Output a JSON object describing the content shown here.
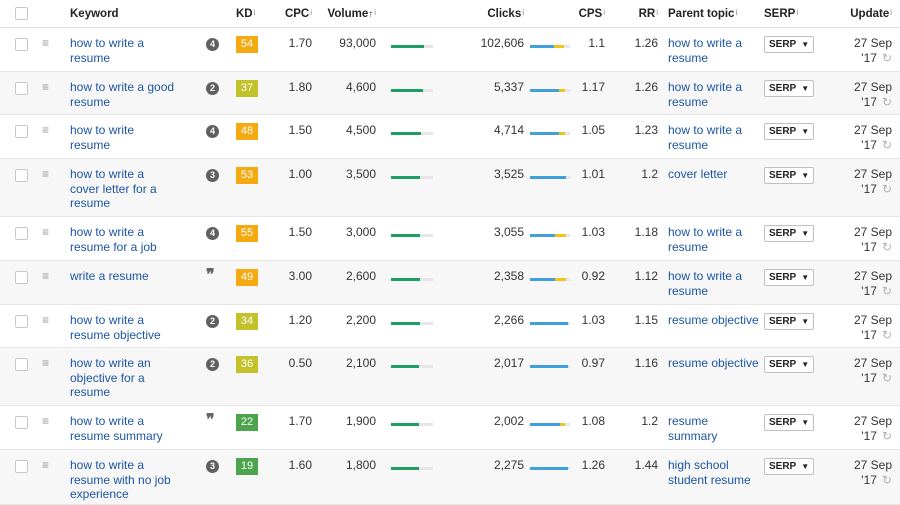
{
  "columns": {
    "keyword": "Keyword",
    "kd": "KD",
    "cpc": "CPC",
    "volume": "Volume",
    "clicks": "Clicks",
    "cps": "CPS",
    "rr": "RR",
    "parent": "Parent topic",
    "serp": "SERP",
    "update": "Update",
    "info": "i",
    "sort_arrow": "↑"
  },
  "kd_colors": {
    "green": "#4ca54c",
    "olive": "#c3c22b",
    "orange": "#f5aa12"
  },
  "bar_colors": {
    "green": "#1f9e62",
    "blue": "#3fa0dd",
    "yellow": "#f2c618",
    "track": "#e6e6e6"
  },
  "rows": [
    {
      "keyword": [
        "how to write a",
        "resume"
      ],
      "badge": "4",
      "kd": "54",
      "kd_color": "#f5aa12",
      "cpc": "1.70",
      "volume": "93,000",
      "vol_fill": 0.78,
      "clicks": "102,606",
      "click_blue": 0.6,
      "click_yellow": 0.25,
      "cps": "1.1",
      "rr": "1.26",
      "parent": [
        "how to write a",
        "resume"
      ],
      "serp": "SERP",
      "update": "27 Sep '17"
    },
    {
      "keyword": [
        "how to write a good",
        "resume"
      ],
      "badge": "2",
      "kd": "37",
      "kd_color": "#c3c22b",
      "cpc": "1.80",
      "volume": "4,600",
      "vol_fill": 0.75,
      "clicks": "5,337",
      "click_blue": 0.72,
      "click_yellow": 0.15,
      "cps": "1.17",
      "rr": "1.26",
      "parent": [
        "how to write a",
        "resume"
      ],
      "serp": "SERP",
      "update": "27 Sep '17"
    },
    {
      "keyword": [
        "how to write",
        "resume"
      ],
      "badge": "4",
      "kd": "48",
      "kd_color": "#f5aa12",
      "cpc": "1.50",
      "volume": "4,500",
      "vol_fill": 0.72,
      "clicks": "4,714",
      "click_blue": 0.72,
      "click_yellow": 0.15,
      "cps": "1.05",
      "rr": "1.23",
      "parent": [
        "how to write a",
        "resume"
      ],
      "serp": "SERP",
      "update": "27 Sep '17"
    },
    {
      "keyword": [
        "how to write a",
        "cover letter for a",
        "resume"
      ],
      "badge": "3",
      "kd": "53",
      "kd_color": "#f5aa12",
      "cpc": "1.00",
      "volume": "3,500",
      "vol_fill": 0.7,
      "clicks": "3,525",
      "click_blue": 0.9,
      "click_yellow": 0.0,
      "cps": "1.01",
      "rr": "1.2",
      "parent": [
        "cover letter"
      ],
      "serp": "SERP",
      "update": "27 Sep '17"
    },
    {
      "keyword": [
        "how to write a",
        "resume for a job"
      ],
      "badge": "4",
      "kd": "55",
      "kd_color": "#f5aa12",
      "cpc": "1.50",
      "volume": "3,000",
      "vol_fill": 0.7,
      "clicks": "3,055",
      "click_blue": 0.62,
      "click_yellow": 0.28,
      "cps": "1.03",
      "rr": "1.18",
      "parent": [
        "how to write a",
        "resume"
      ],
      "serp": "SERP",
      "update": "27 Sep '17"
    },
    {
      "keyword": [
        "write a resume"
      ],
      "badge": "",
      "quote": "❞",
      "kd": "49",
      "kd_color": "#f5aa12",
      "cpc": "3.00",
      "volume": "2,600",
      "vol_fill": 0.68,
      "clicks": "2,358",
      "click_blue": 0.62,
      "click_yellow": 0.28,
      "cps": "0.92",
      "rr": "1.12",
      "parent": [
        "how to write a",
        "resume"
      ],
      "serp": "SERP",
      "update": "27 Sep '17"
    },
    {
      "keyword": [
        "how to write a",
        "resume objective"
      ],
      "badge": "2",
      "kd": "34",
      "kd_color": "#c3c22b",
      "cpc": "1.20",
      "volume": "2,200",
      "vol_fill": 0.68,
      "clicks": "2,266",
      "click_blue": 0.95,
      "click_yellow": 0.0,
      "cps": "1.03",
      "rr": "1.15",
      "parent": [
        "resume objective"
      ],
      "serp": "SERP",
      "update": "27 Sep '17"
    },
    {
      "keyword": [
        "how to write an",
        "objective for a",
        "resume"
      ],
      "badge": "2",
      "kd": "36",
      "kd_color": "#c3c22b",
      "cpc": "0.50",
      "volume": "2,100",
      "vol_fill": 0.66,
      "clicks": "2,017",
      "click_blue": 0.95,
      "click_yellow": 0.0,
      "cps": "0.97",
      "rr": "1.16",
      "parent": [
        "resume objective"
      ],
      "serp": "SERP",
      "update": "27 Sep '17"
    },
    {
      "keyword": [
        "how to write a",
        "resume summary"
      ],
      "badge": "",
      "quote": "❞",
      "kd": "22",
      "kd_color": "#4ca54c",
      "cpc": "1.70",
      "volume": "1,900",
      "vol_fill": 0.66,
      "clicks": "2,002",
      "click_blue": 0.74,
      "click_yellow": 0.14,
      "cps": "1.08",
      "rr": "1.2",
      "parent": [
        "resume summary"
      ],
      "serp": "SERP",
      "update": "27 Sep '17"
    },
    {
      "keyword": [
        "how to write a",
        "resume with no job",
        "experience"
      ],
      "badge": "3",
      "kd": "19",
      "kd_color": "#4ca54c",
      "cpc": "1.60",
      "volume": "1,800",
      "vol_fill": 0.66,
      "clicks": "2,275",
      "click_blue": 0.95,
      "click_yellow": 0.0,
      "cps": "1.26",
      "rr": "1.44",
      "parent": [
        "high school",
        "student resume"
      ],
      "serp": "SERP",
      "update": "27 Sep '17"
    }
  ]
}
